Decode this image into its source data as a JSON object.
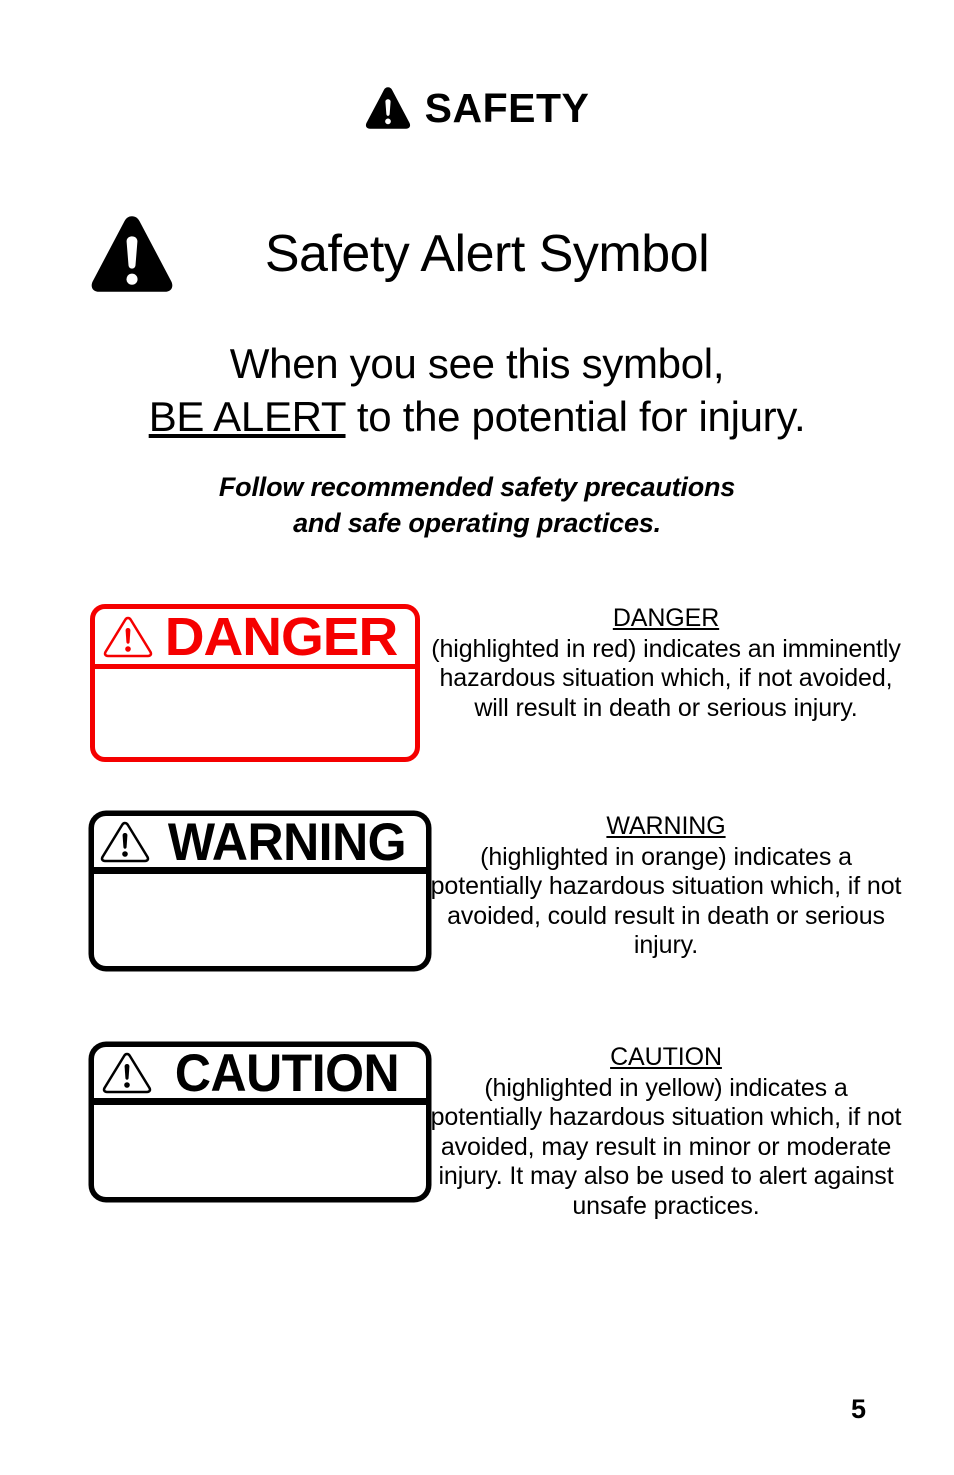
{
  "header": {
    "icon": "safety-alert-triangle-icon",
    "title": "SAFETY"
  },
  "title_block": {
    "icon": "safety-alert-triangle-icon",
    "title": "Safety Alert Symbol"
  },
  "lead": {
    "line1": "When you see this symbol,",
    "emphasis": "BE ALERT",
    "line2_rest": " to the potential for injury."
  },
  "subnote": {
    "line1": "Follow recommended safety precautions",
    "line2": "and safe operating practices."
  },
  "signal_words": [
    {
      "key": "danger",
      "placard_word": "DANGER",
      "placard_icon": "warning-triangle-outline-icon",
      "color": "#f50000",
      "heading": "DANGER",
      "body": "(highlighted in red) indicates an imminently hazardous situation which, if not avoided, will result in death or serious injury."
    },
    {
      "key": "warning",
      "placard_word": "WARNING",
      "placard_icon": "warning-triangle-outline-icon",
      "color": "#000000",
      "heading": "WARNING",
      "body": "(highlighted in orange) indicates a potentially hazardous situation which, if not avoided, could result in death or serious injury."
    },
    {
      "key": "caution",
      "placard_word": "CAUTION",
      "placard_icon": "warning-triangle-outline-icon",
      "color": "#000000",
      "heading": "CAUTION",
      "body": "(highlighted in yellow) indicates a potentially hazardous situation which, if not avoided, may result in minor or moderate injury.  It may also be used to alert against unsafe practices."
    }
  ],
  "footer": {
    "page_number": "5"
  }
}
